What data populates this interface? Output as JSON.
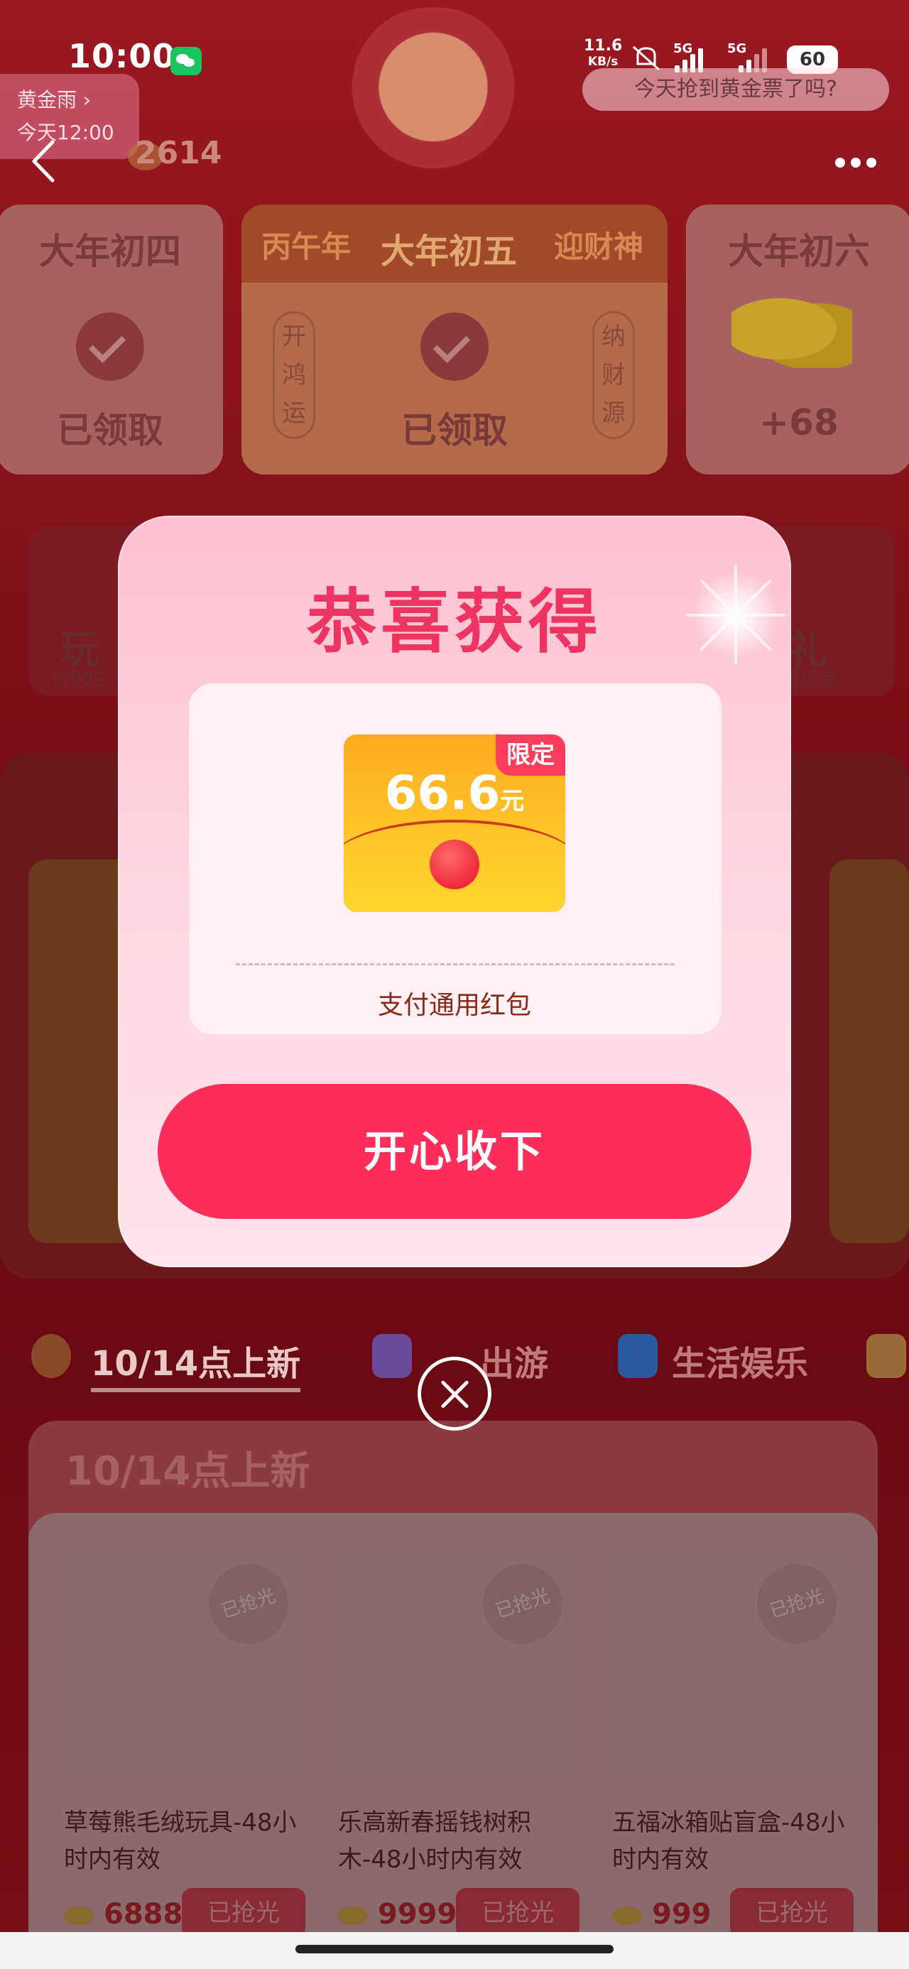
{
  "status_bar": {
    "time": "10:00",
    "net_speed_value": "11.6",
    "net_speed_unit": "KB/s",
    "sig1": "5G",
    "sig2": "5G",
    "battery": "60"
  },
  "header": {
    "gold_rain_label": "黄金雨 ›",
    "gold_rain_time": "今天12:00",
    "coin_count": "2614",
    "bubble_text": "今天抢到黄金票了吗?"
  },
  "day_cards": {
    "left": {
      "title": "大年初四",
      "state": "已领取"
    },
    "middle": {
      "tag_left": "丙午年",
      "title": "大年初五",
      "tag_right": "迎财神",
      "side_left": "开鸿运",
      "side_right": "纳财源",
      "state": "已领取"
    },
    "right": {
      "title": "大年初六",
      "reward": "+68"
    }
  },
  "promos": {
    "left_title": "玩",
    "left_sub": "得999",
    "right_title": "礼",
    "right_sub": "鸿运金"
  },
  "tabs": {
    "items": [
      "10/14点上新",
      "出游",
      "生活娱乐"
    ]
  },
  "list": {
    "title": "10/14点上新",
    "products": [
      {
        "name": "草莓熊毛绒玩具-48小时内有效",
        "price": "6888",
        "status": "已抢光",
        "badge": "已抢光"
      },
      {
        "name": "乐高新春摇钱树积木-48小时内有效",
        "price": "9999",
        "status": "已抢光",
        "badge": "已抢光"
      },
      {
        "name": "五福冰箱贴盲盒-48小时内有效",
        "price": "999",
        "status": "已抢光",
        "badge": "已抢光"
      }
    ]
  },
  "modal": {
    "title": "恭喜获得",
    "amount": "66.6",
    "currency": "元",
    "limit_tag": "限定",
    "reward_label": "支付通用红包",
    "accept_label": "开心收下"
  },
  "colors": {
    "accent": "#ff2d5a",
    "title": "#ee3460",
    "envelope": "#ffc42a",
    "background": "#7a0e18"
  }
}
